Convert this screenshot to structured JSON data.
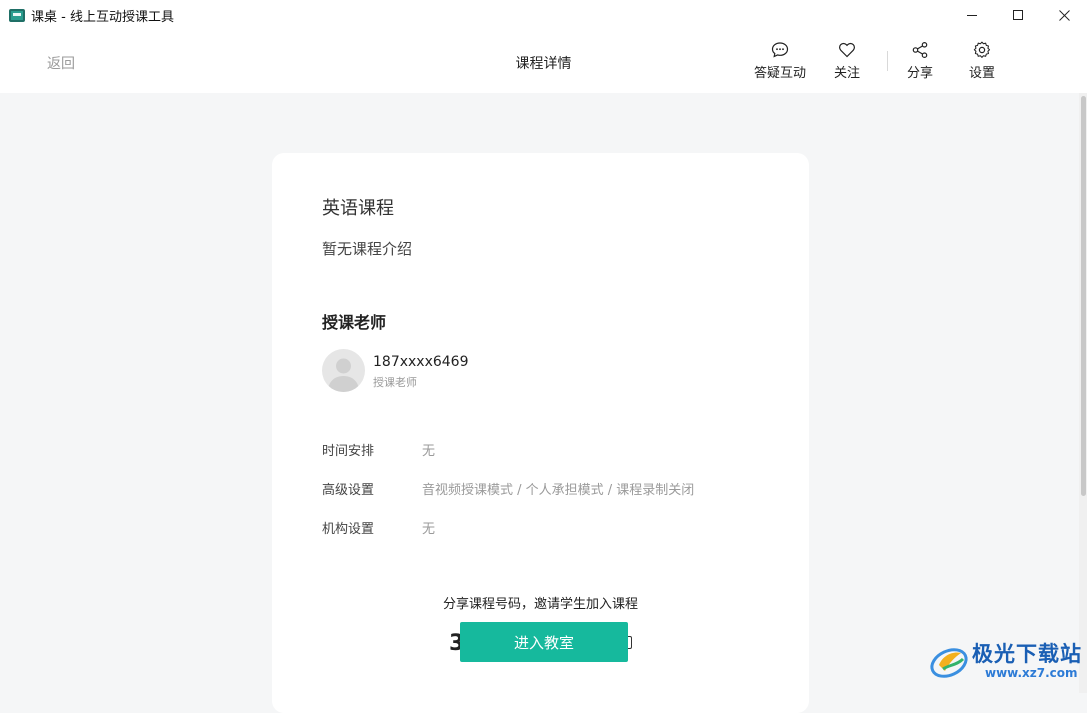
{
  "window": {
    "title": "课桌 - 线上互动授课工具",
    "icons": {
      "app": "classroom-app-icon",
      "minimize": "minimize-icon",
      "maximize": "maximize-icon",
      "close": "close-icon"
    }
  },
  "header": {
    "back_label": "返回",
    "title": "课程详情",
    "actions": [
      {
        "label": "答疑互动",
        "icon": "chat-bubble-icon"
      },
      {
        "label": "关注",
        "icon": "heart-icon"
      },
      {
        "label": "分享",
        "icon": "share-icon"
      },
      {
        "label": "设置",
        "icon": "gear-icon"
      }
    ]
  },
  "course": {
    "name": "英语课程",
    "description": "暂无课程介绍",
    "teacher_section_title": "授课老师",
    "teacher": {
      "name": "187xxxx6469",
      "role": "授课老师"
    },
    "info": [
      {
        "key": "时间安排",
        "value": "无"
      },
      {
        "key": "高级设置",
        "value": "音视频授课模式 / 个人承担模式 / 课程录制关闭"
      },
      {
        "key": "机构设置",
        "value": "无"
      }
    ],
    "share_hint": "分享课程号码，邀请学生加入课程",
    "code_partial": "3",
    "enter_button": "进入教室"
  },
  "watermark": {
    "text": "极光下载站",
    "url": "www.xz7.com"
  },
  "colors": {
    "accent": "#16b99d",
    "background": "#f5f6f7",
    "card": "#ffffff",
    "watermark": "#1a5fb4"
  }
}
